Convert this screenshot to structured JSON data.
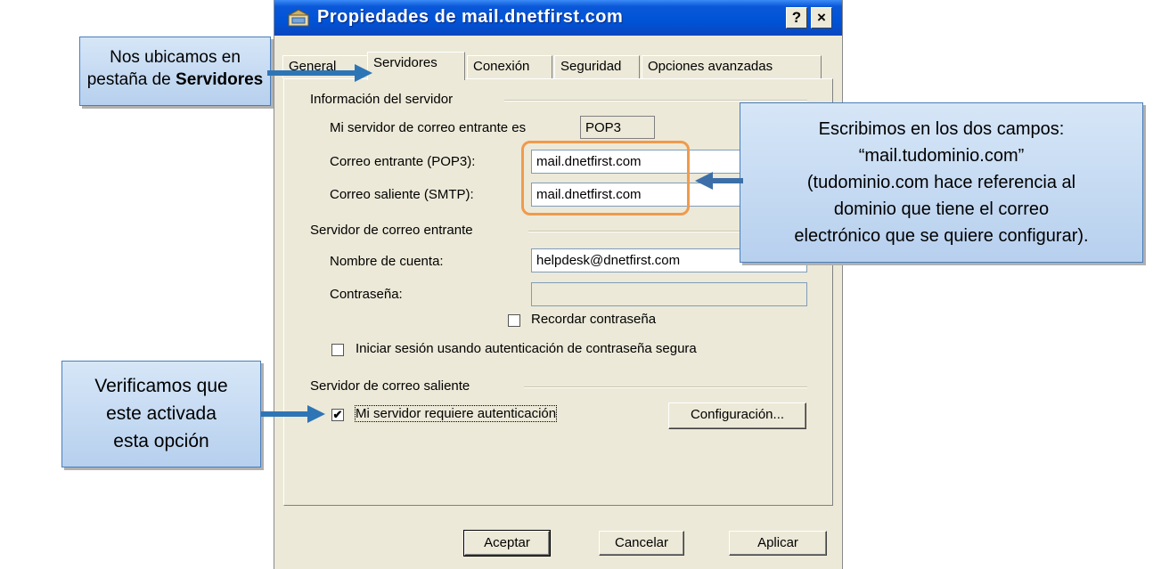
{
  "window": {
    "title": "Propiedades de mail.dnetfirst.com",
    "help_button": "?",
    "close_button": "×"
  },
  "tabs": [
    "General",
    "Servidores",
    "Conexión",
    "Seguridad",
    "Opciones avanzadas"
  ],
  "active_tab": "Servidores",
  "server_info": {
    "group_label": "Información del servidor",
    "incoming_type_label": "Mi servidor de correo entrante es",
    "incoming_type_value": "POP3",
    "incoming_label": "Correo entrante (POP3):",
    "incoming_value": "mail.dnetfirst.com",
    "outgoing_label": "Correo saliente (SMTP):",
    "outgoing_value": "mail.dnetfirst.com"
  },
  "incoming_server": {
    "group_label": "Servidor de correo entrante",
    "account_label": "Nombre de cuenta:",
    "account_value": "helpdesk@dnetfirst.com",
    "password_label": "Contraseña:",
    "password_value": "",
    "remember_label": "Recordar contraseña",
    "remember_checked": false,
    "spa_label": "Iniciar sesión usando autenticación de contraseña segura",
    "spa_checked": false
  },
  "outgoing_server": {
    "group_label": "Servidor de correo saliente",
    "auth_label": "Mi servidor requiere autenticación",
    "auth_checked": true,
    "settings_button": "Configuración..."
  },
  "buttons": {
    "ok": "Aceptar",
    "cancel": "Cancelar",
    "apply": "Aplicar"
  },
  "callouts": {
    "tab_note": {
      "line1": "Nos ubicamos en",
      "line2_prefix": "pestaña de ",
      "line2_bold": "Servidores"
    },
    "fields_note": [
      "Escribimos en los dos campos:",
      "“mail.tudominio.com”",
      "(tudominio.com hace referencia al",
      "dominio que tiene el correo",
      "electrónico que se quiere configurar)."
    ],
    "auth_note": [
      "Verificamos que",
      "este activada",
      "esta opción"
    ]
  },
  "colors": {
    "title_bar": "#0053d6",
    "callout_fill": "#b7d0ee",
    "callout_border": "#4a7ebb",
    "arrow": "#2e75b6",
    "highlight": "#f09a4d"
  }
}
